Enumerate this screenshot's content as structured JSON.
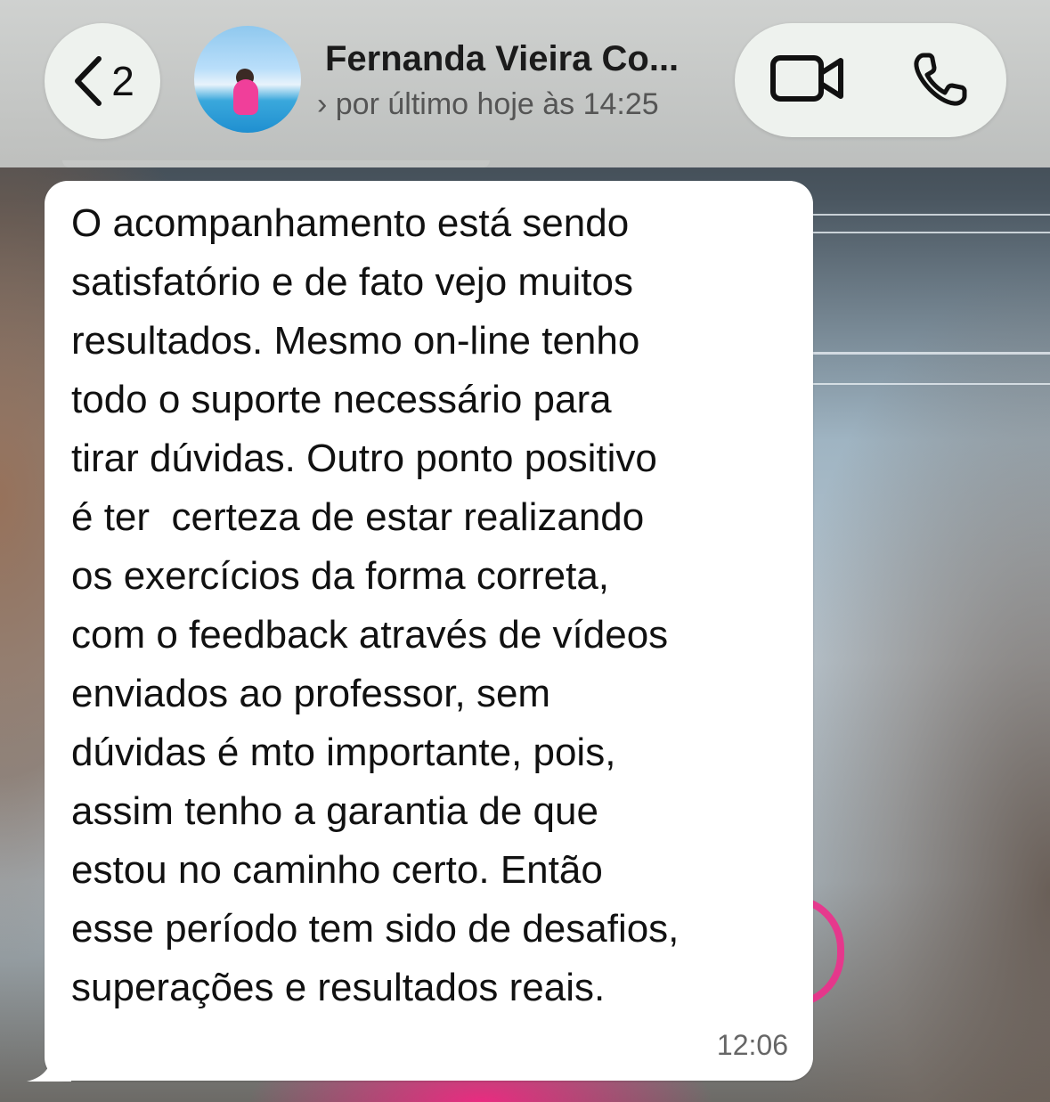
{
  "header": {
    "back_count": "2",
    "contact_name": "Fernanda Vieira Co...",
    "contact_status": "› por último hoje às 14:25"
  },
  "icons": {
    "back": "chevron-left-icon",
    "video": "video-camera-icon",
    "phone": "phone-icon",
    "avatar": "contact-avatar"
  },
  "message": {
    "text": "O acompanhamento está sendo\nsatisfatório e de fato vejo muitos\nresultados. Mesmo on-line tenho\ntodo o suporte necessário para\ntirar dúvidas. Outro ponto positivo\né ter  certeza de estar realizando\nos exercícios da forma correta,\ncom o feedback através de vídeos\nenviados ao professor, sem\ndúvidas é mto importante, pois,\nassim tenho a garantia de que\nestou no caminho certo. Então\nesse período tem sido de desafios,\nsuperações e resultados reais.",
    "time": "12:06"
  },
  "colors": {
    "bubble": "#ffffff",
    "header": "#d4d6d4",
    "pill": "#eef2ee",
    "text": "#111111",
    "accent_pink": "#ef2f8c"
  }
}
